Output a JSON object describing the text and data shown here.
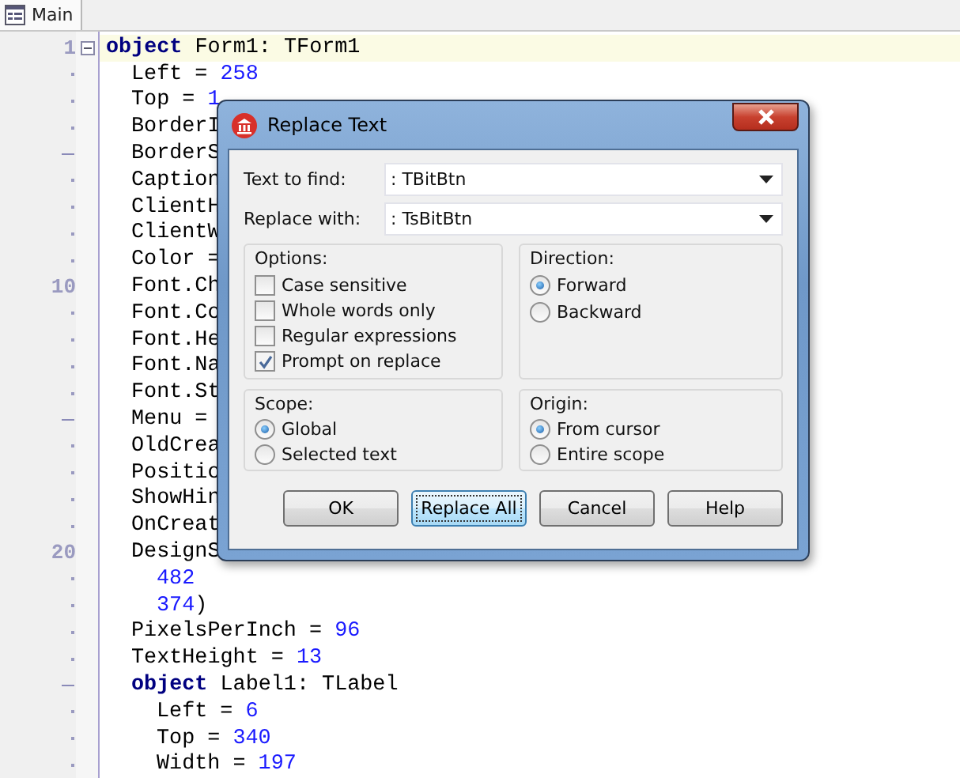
{
  "tab": {
    "label": "Main"
  },
  "code": [
    {
      "gutter": "1",
      "kind": "number",
      "fold": true,
      "current": true,
      "tokens": [
        {
          "kind": "keyword",
          "text": "object"
        },
        {
          "kind": "plain",
          "text": " Form1: TForm1"
        }
      ],
      "children": [
        {
          "kind": "dot",
          "tokens": [
            {
              "kind": "plain",
              "text": "Left = "
            },
            {
              "kind": "number",
              "text": "258"
            }
          ]
        },
        {
          "kind": "dot",
          "tokens": [
            {
              "kind": "plain",
              "text": "Top = "
            },
            {
              "kind": "number",
              "text": "1"
            }
          ]
        },
        {
          "kind": "dot",
          "tokens": [
            {
              "kind": "plain",
              "text": "BorderI"
            }
          ]
        },
        {
          "kind": "dash",
          "tokens": [
            {
              "kind": "plain",
              "text": "BorderS"
            }
          ]
        },
        {
          "kind": "dot",
          "tokens": [
            {
              "kind": "plain",
              "text": "Caption"
            }
          ]
        },
        {
          "kind": "dot",
          "tokens": [
            {
              "kind": "plain",
              "text": "ClientH"
            }
          ]
        },
        {
          "kind": "dot",
          "tokens": [
            {
              "kind": "plain",
              "text": "ClientW"
            }
          ]
        },
        {
          "kind": "dot",
          "tokens": [
            {
              "kind": "plain",
              "text": "Color ="
            }
          ]
        },
        {
          "gutter": "10",
          "kind": "number",
          "tokens": [
            {
              "kind": "plain",
              "text": "Font.Ch"
            }
          ]
        },
        {
          "kind": "dot",
          "tokens": [
            {
              "kind": "plain",
              "text": "Font.Co"
            }
          ]
        },
        {
          "kind": "dot",
          "tokens": [
            {
              "kind": "plain",
              "text": "Font.He"
            }
          ]
        },
        {
          "kind": "dot",
          "tokens": [
            {
              "kind": "plain",
              "text": "Font.Na"
            }
          ]
        },
        {
          "kind": "dot",
          "tokens": [
            {
              "kind": "plain",
              "text": "Font.St"
            }
          ]
        },
        {
          "kind": "dash",
          "tokens": [
            {
              "kind": "plain",
              "text": "Menu ="
            }
          ]
        },
        {
          "kind": "dot",
          "tokens": [
            {
              "kind": "plain",
              "text": "OldCrea"
            }
          ]
        },
        {
          "kind": "dot",
          "tokens": [
            {
              "kind": "plain",
              "text": "Positio"
            }
          ]
        },
        {
          "kind": "dot",
          "tokens": [
            {
              "kind": "plain",
              "text": "ShowHin"
            }
          ]
        },
        {
          "kind": "dot",
          "tokens": [
            {
              "kind": "plain",
              "text": "OnCreat"
            }
          ]
        },
        {
          "gutter": "20",
          "kind": "number",
          "tokens": [
            {
              "kind": "plain",
              "text": "DesignS"
            }
          ],
          "children": [
            {
              "kind": "dot",
              "tokens": [
                {
                  "kind": "number",
                  "text": "482"
                }
              ]
            },
            {
              "kind": "dot",
              "tokens": [
                {
                  "kind": "number",
                  "text": "374"
                },
                {
                  "kind": "plain",
                  "text": ")"
                }
              ]
            }
          ]
        },
        {
          "kind": "dot",
          "tokens": [
            {
              "kind": "plain",
              "text": "PixelsPerInch = "
            },
            {
              "kind": "number",
              "text": "96"
            }
          ]
        },
        {
          "kind": "dot",
          "tokens": [
            {
              "kind": "plain",
              "text": "TextHeight = "
            },
            {
              "kind": "number",
              "text": "13"
            }
          ]
        },
        {
          "kind": "dash",
          "tokens": [
            {
              "kind": "keyword",
              "text": "object"
            },
            {
              "kind": "plain",
              "text": " Label1: TLabel"
            }
          ],
          "children": [
            {
              "kind": "dot",
              "tokens": [
                {
                  "kind": "plain",
                  "text": "Left = "
                },
                {
                  "kind": "number",
                  "text": "6"
                }
              ]
            },
            {
              "kind": "dot",
              "tokens": [
                {
                  "kind": "plain",
                  "text": "Top = "
                },
                {
                  "kind": "number",
                  "text": "340"
                }
              ]
            },
            {
              "kind": "dot",
              "tokens": [
                {
                  "kind": "plain",
                  "text": "Width = "
                },
                {
                  "kind": "number",
                  "text": "197"
                }
              ]
            }
          ]
        }
      ]
    }
  ],
  "dialog": {
    "title": "Replace Text",
    "fields": [
      {
        "label": "Text to find:",
        "value": ": TBitBtn"
      },
      {
        "label": "Replace with:",
        "value": ": TsBitBtn"
      }
    ],
    "options": {
      "title": "Options:",
      "items": [
        {
          "label": "Case sensitive",
          "checked": false
        },
        {
          "label": "Whole words only",
          "checked": false
        },
        {
          "label": "Regular expressions",
          "checked": false
        },
        {
          "label": "Prompt on replace",
          "checked": true
        }
      ]
    },
    "direction": {
      "title": "Direction:",
      "items": [
        {
          "label": "Forward",
          "selected": true
        },
        {
          "label": "Backward",
          "selected": false
        }
      ]
    },
    "scope": {
      "title": "Scope:",
      "items": [
        {
          "label": "Global",
          "selected": true
        },
        {
          "label": "Selected text",
          "selected": false
        }
      ]
    },
    "origin": {
      "title": "Origin:",
      "items": [
        {
          "label": "From cursor",
          "selected": true
        },
        {
          "label": "Entire scope",
          "selected": false
        }
      ]
    },
    "buttons": [
      {
        "label": "OK",
        "focused": false
      },
      {
        "label": "Replace All",
        "focused": true
      },
      {
        "label": "Cancel",
        "focused": false
      },
      {
        "label": "Help",
        "focused": false
      }
    ]
  }
}
